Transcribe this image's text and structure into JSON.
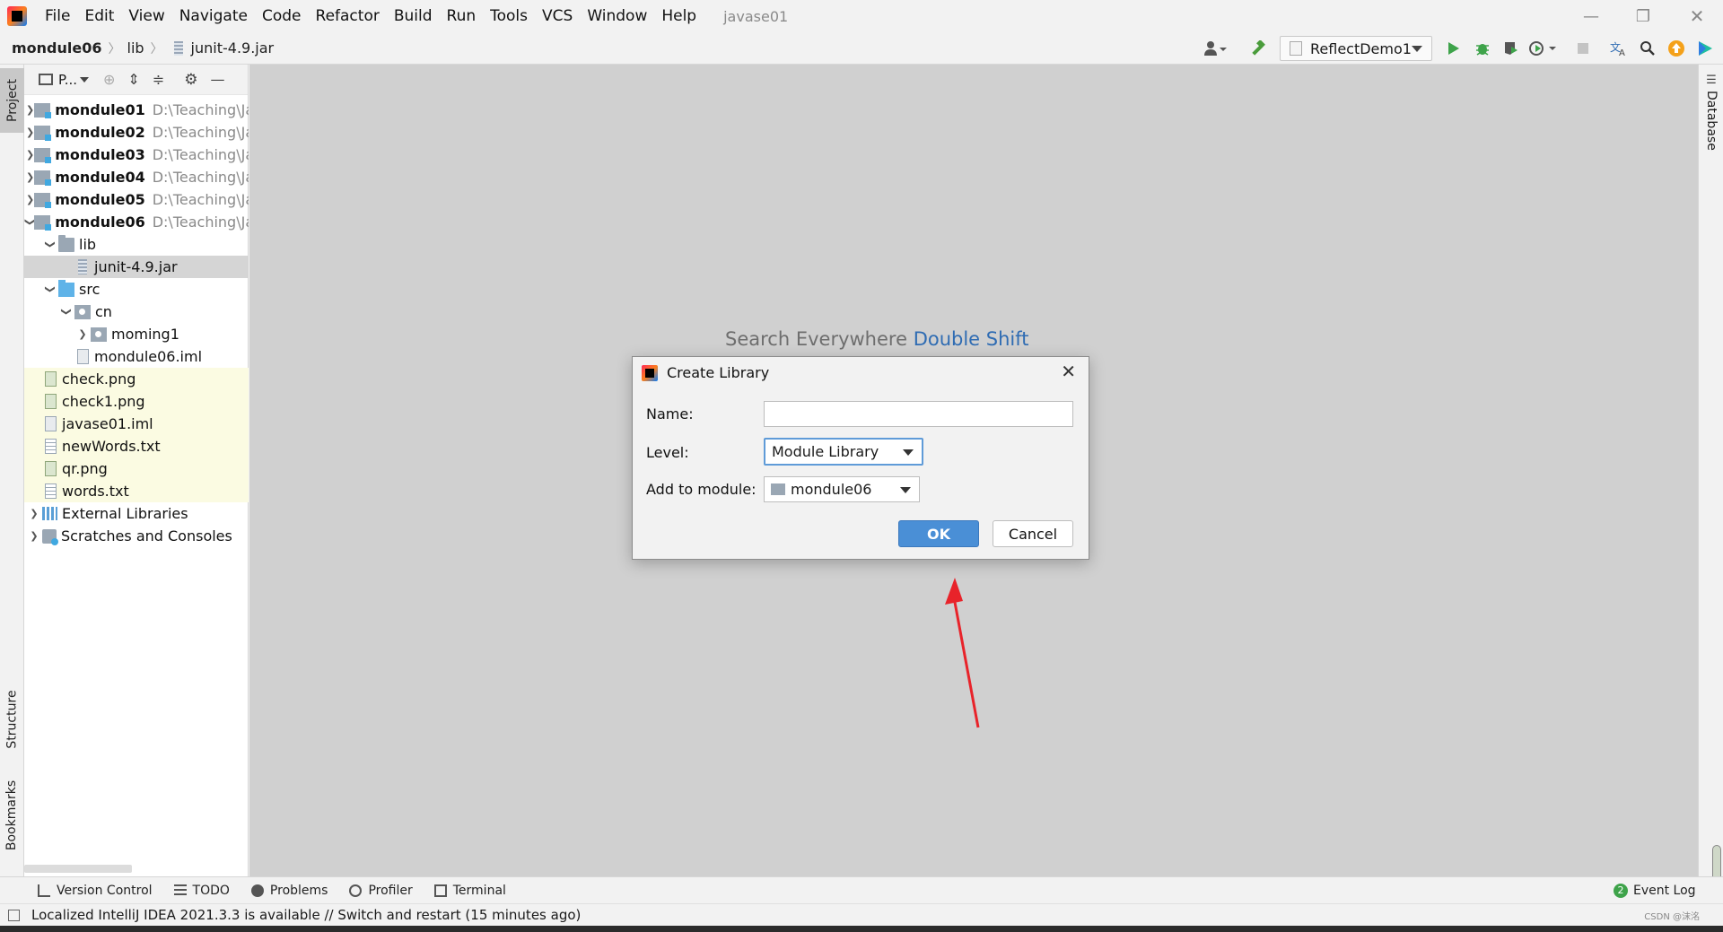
{
  "menu": [
    "File",
    "Edit",
    "View",
    "Navigate",
    "Code",
    "Refactor",
    "Build",
    "Run",
    "Tools",
    "VCS",
    "Window",
    "Help"
  ],
  "window_title": "javase01",
  "breadcrumb": [
    "mondule06",
    "lib",
    "junit-4.9.jar"
  ],
  "run_config": "ReflectDemo1",
  "project_panel": {
    "view_label": "P...",
    "tree": [
      {
        "name": "mondule01",
        "path": "D:\\Teaching\\Ja",
        "bold": true,
        "icon": "module",
        "arrow": "collapsed"
      },
      {
        "name": "mondule02",
        "path": "D:\\Teaching\\Ja",
        "bold": true,
        "icon": "module",
        "arrow": "collapsed"
      },
      {
        "name": "mondule03",
        "path": "D:\\Teaching\\Ja",
        "bold": true,
        "icon": "module",
        "arrow": "collapsed"
      },
      {
        "name": "mondule04",
        "path": "D:\\Teaching\\Ja",
        "bold": true,
        "icon": "module",
        "arrow": "collapsed"
      },
      {
        "name": "mondule05",
        "path": "D:\\Teaching\\Ja",
        "bold": true,
        "icon": "module",
        "arrow": "collapsed"
      },
      {
        "name": "mondule06",
        "path": "D:\\Teaching\\Ja",
        "bold": true,
        "icon": "module",
        "arrow": "expanded"
      },
      {
        "name": "lib",
        "icon": "folder",
        "arrow": "expanded"
      },
      {
        "name": "junit-4.9.jar",
        "icon": "jar",
        "selected": true
      },
      {
        "name": "src",
        "icon": "src",
        "arrow": "expanded"
      },
      {
        "name": "cn",
        "icon": "pkg",
        "arrow": "expanded"
      },
      {
        "name": "moming1",
        "icon": "pkg",
        "arrow": "collapsed"
      },
      {
        "name": "mondule06.iml",
        "icon": "file"
      },
      {
        "name": "check.png",
        "icon": "img",
        "highlight": true
      },
      {
        "name": "check1.png",
        "icon": "img",
        "highlight": true
      },
      {
        "name": "javase01.iml",
        "icon": "file",
        "highlight": true
      },
      {
        "name": "newWords.txt",
        "icon": "txt",
        "highlight": true
      },
      {
        "name": "qr.png",
        "icon": "img",
        "highlight": true
      },
      {
        "name": "words.txt",
        "icon": "txt",
        "highlight": true
      },
      {
        "name": "External Libraries",
        "icon": "lib",
        "arrow": "collapsed"
      },
      {
        "name": "Scratches and Consoles",
        "icon": "scratch",
        "arrow": "collapsed"
      }
    ]
  },
  "left_stripe": {
    "project": "Project",
    "structure": "Structure",
    "bookmarks": "Bookmarks"
  },
  "right_stripe": {
    "database": "Database"
  },
  "editor_hint": {
    "text": "Search Everywhere",
    "shortcut": "Double Shift"
  },
  "dialog": {
    "title": "Create Library",
    "name_label": "Name:",
    "name_value": "",
    "level_label": "Level:",
    "level_value": "Module Library",
    "module_label": "Add to module:",
    "module_value": "mondule06",
    "ok": "OK",
    "cancel": "Cancel"
  },
  "bottom_tabs": [
    "Version Control",
    "TODO",
    "Problems",
    "Profiler",
    "Terminal"
  ],
  "event_log": {
    "count": "2",
    "label": "Event Log"
  },
  "status": "Localized IntelliJ IDEA 2021.3.3 is available // Switch and restart (15 minutes ago)",
  "watermark": "CSDN @沫洺",
  "colors": {
    "accent": "#4a8fd6",
    "selection": "#d5d5d5",
    "highlight_row": "#fbfbe2",
    "editor_bg": "#d0d0d0",
    "annotation_arrow": "#e8232a"
  }
}
